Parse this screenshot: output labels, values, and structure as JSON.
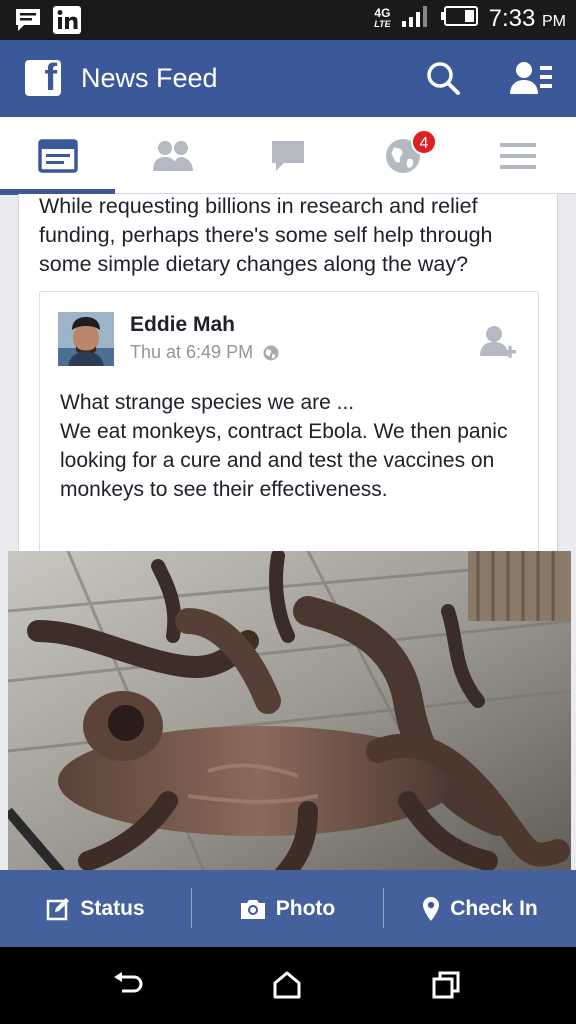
{
  "status_bar": {
    "time": "7:33",
    "ampm": "PM",
    "network": "4G",
    "network_sub": "LTE",
    "notification_icons": [
      "message-icon",
      "linkedin-icon"
    ]
  },
  "app_bar": {
    "logo_letter": "f",
    "title": "News Feed",
    "icons": [
      "search-icon",
      "friend-requests-icon"
    ]
  },
  "tabs": [
    {
      "name": "news-feed",
      "icon": "news-feed-icon",
      "active": true
    },
    {
      "name": "friends",
      "icon": "friends-icon",
      "active": false
    },
    {
      "name": "messages",
      "icon": "chat-bubble-icon",
      "active": false
    },
    {
      "name": "notifications",
      "icon": "globe-icon",
      "active": false,
      "badge": "4"
    },
    {
      "name": "more",
      "icon": "menu-icon",
      "active": false
    }
  ],
  "post": {
    "text": "While requesting billions in research and relief funding, perhaps there's some self help through some simple dietary changes along the way?",
    "shared": {
      "author": "Eddie Mah",
      "timestamp": "Thu at 6:49 PM",
      "privacy_icon": "globe-icon",
      "text_lines": [
        "What strange species we are ...",
        "We eat  monkeys, contract Ebola. We then panic looking for a cure and and test the vaccines on monkeys to see their effectiveness."
      ]
    }
  },
  "composer": {
    "status_label": "Status",
    "photo_label": "Photo",
    "checkin_label": "Check In"
  },
  "nav_bar": {
    "buttons": [
      "back-icon",
      "home-icon",
      "recents-icon"
    ]
  },
  "colors": {
    "brand": "#3b5998",
    "badge": "#e02020",
    "text": "#1d2129",
    "meta": "#90949c"
  }
}
